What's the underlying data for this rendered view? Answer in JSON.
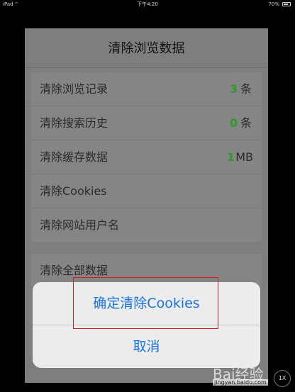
{
  "status_bar": {
    "device": "iPad",
    "time": "下午4:20",
    "battery": "70%",
    "battery_level": 0.7
  },
  "sheet": {
    "title": "清除浏览数据",
    "items": [
      {
        "label": "清除浏览记录",
        "count": "3",
        "unit": "条"
      },
      {
        "label": "清除搜索历史",
        "count": "0",
        "unit": "条"
      },
      {
        "label": "清除缓存数据",
        "count": "1",
        "unit": "MB"
      },
      {
        "label": "清除Cookies"
      },
      {
        "label": "清除网站用户名"
      }
    ],
    "all_data_label": "清除全部数据"
  },
  "action_sheet": {
    "confirm_label": "确定清除Cookies",
    "cancel_label": "取消"
  },
  "watermark": {
    "brand": "Bai经验",
    "url": "jingyan.baidu.com"
  },
  "zoom_badge": "1X",
  "colors": {
    "accent": "#1a73e8",
    "count_green": "#2d9a2a",
    "highlight": "#d02020"
  }
}
